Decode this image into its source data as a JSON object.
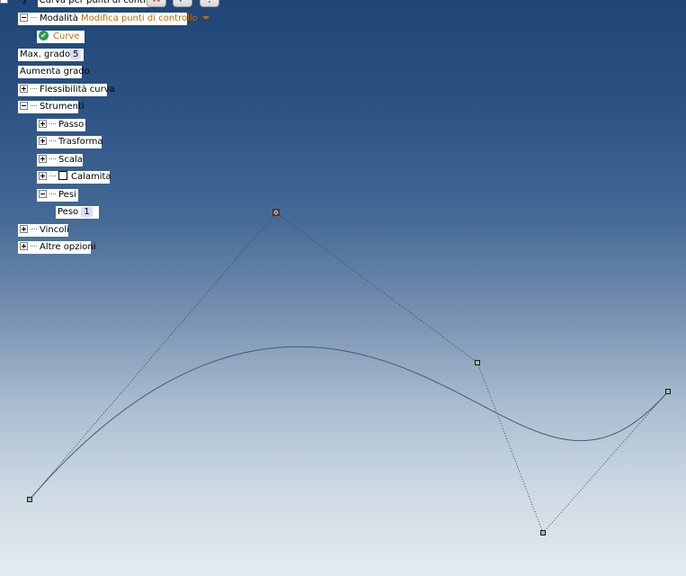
{
  "tree": {
    "root_label": "Curva per punti di controllo",
    "mode_label": "Modalità",
    "mode_value": "Modifica punti di controllo",
    "curve_item": "Curve",
    "max_degree_label": "Max. grado",
    "max_degree_value": "5",
    "raise_degree": "Aumenta grado",
    "curve_flex": "Flessibilità curva",
    "tools": "Strumenti",
    "step": "Passo",
    "transform": "Trasforma",
    "scale": "Scala",
    "magnet": "Calamita",
    "weights": "Pesi",
    "weight_label": "Peso",
    "weight_value": "1",
    "constraints": "Vincoli",
    "more_options": "Altre opzioni"
  },
  "toolbar": {
    "cancel_icon": "close-icon",
    "ok_icon": "check-icon",
    "info_icon": "info-icon"
  },
  "colors": {
    "accent": "#c46a00",
    "field_bg": "#d8dcf6",
    "curve": "#4a5a6e",
    "ok_green": "#2b9a52",
    "cancel_red": "#d22020"
  },
  "curve": {
    "control_points": [
      [
        33,
        555
      ],
      [
        307,
        236
      ],
      [
        531,
        403
      ],
      [
        604,
        592
      ],
      [
        743,
        435
      ]
    ],
    "selected_point_index": 1,
    "degree": 4
  }
}
